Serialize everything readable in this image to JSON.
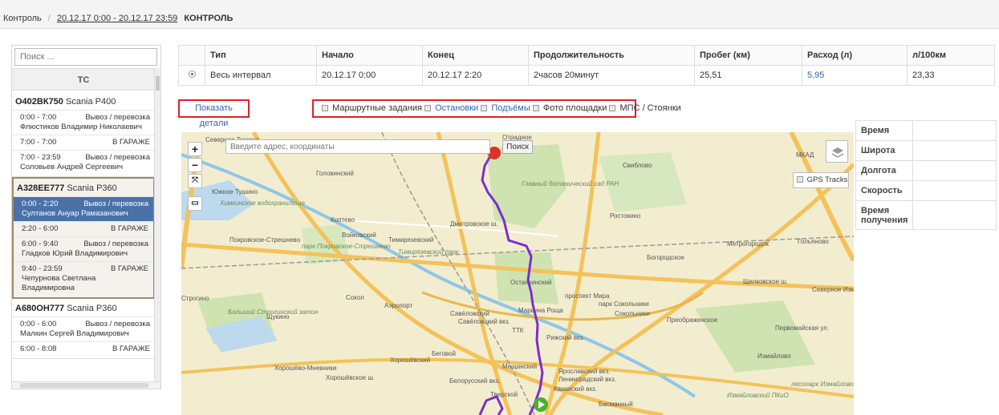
{
  "breadcrumb": {
    "root": "Контроль",
    "range": "20.12.17 0:00 - 20.12.17 23:59",
    "current": "КОНТРОЛЬ"
  },
  "sidebar": {
    "search_placeholder": "Поиск ...",
    "header": "ТС",
    "vehicles": [
      {
        "plate": "О402ВК750",
        "model": "Scania P400",
        "trips": [
          {
            "time": "0:00 - 7:00",
            "status": "Вывоз / перевозка",
            "driver": "Флюстиков Владимир Николаевич"
          },
          {
            "time": "7:00 - 7:00",
            "status": "В ГАРАЖЕ",
            "driver": ""
          },
          {
            "time": "7:00 - 23:59",
            "status": "Вывоз / перевозка",
            "driver": "Соловьев Андрей Сергеевич"
          }
        ]
      },
      {
        "plate": "А328ЕЕ777",
        "model": "Scania P360",
        "trips": [
          {
            "time": "0:00 - 2:20",
            "status": "Вывоз / перевозка",
            "driver": "Султанов Ануар Рамазанович"
          },
          {
            "time": "2:20 - 6:00",
            "status": "В ГАРАЖЕ",
            "driver": ""
          },
          {
            "time": "6:00 - 9:40",
            "status": "Вывоз / перевозка",
            "driver": "Гладков Юрий Владимирович"
          },
          {
            "time": "9:40 - 23:59",
            "status": "В ГАРАЖЕ",
            "driver": "Чепурнова Светлана Владимировна"
          }
        ]
      },
      {
        "plate": "А680ОН777",
        "model": "Scania P360",
        "trips": [
          {
            "time": "0:00 - 6:00",
            "status": "Вывоз / перевозка",
            "driver": "Малкин Сергей Владимирович"
          },
          {
            "time": "6:00 - 8:08",
            "status": "В ГАРАЖЕ",
            "driver": ""
          }
        ]
      }
    ]
  },
  "table": {
    "headers": [
      "",
      "Тип",
      "Начало",
      "Конец",
      "Продолжительность",
      "Пробег (км)",
      "Расход (л)",
      "л/100км"
    ],
    "row": {
      "type": "Весь интервал",
      "start": "20.12.17 0:00",
      "end": "20.12.17 2:20",
      "duration": "2часов 20минут",
      "mileage": "25,51",
      "consumption": "5,95",
      "per100": "23,33"
    }
  },
  "details_button": "Показать детали",
  "filters": [
    "Маршрутные задания",
    "Остановки",
    "Подъёмы",
    "Фото площадки",
    "МПС / Стоянки"
  ],
  "map": {
    "address_placeholder": "Введите адрес, координаты",
    "search_label": "Поиск",
    "gps_label": "GPS Tracks",
    "labels": [
      "Северное Тушино",
      "Головинский",
      "Южное Тушино",
      "Химкинское водохранилище",
      "Коптево",
      "Войковский",
      "Покровское-Стрешнево",
      "парк Покровское-Стрешнево",
      "Тимирязевский",
      "Тимирязевский парк",
      "Дмитровское ш.",
      "Отрадное",
      "Свиблово",
      "Главный ботанический сад РАН",
      "Ростокино",
      "Богородское",
      "Метрогородок",
      "Гольяново",
      "Останкинский",
      "Сокол",
      "Аэропорт",
      "Щукино",
      "Строгино",
      "Большой Строгинский затон",
      "Савёловский",
      "Савёловский вкз.",
      "Марьина Роща",
      "Рижский вкз.",
      "ТТК",
      "проспект Мира",
      "парк Сокольники",
      "Сокольники",
      "Преображенское",
      "Щелковское ш.",
      "Северное Измайлово",
      "Первомайская ул.",
      "Хорошёвский",
      "Беговой",
      "Мещанский",
      "Хорошёво-Мневники",
      "Хорошёвское ш.",
      "Белорусский вкз.",
      "Тверской",
      "Ярославский вкз.",
      "Ленинградский вкз.",
      "Казанский вкз.",
      "Басманный",
      "Измайлово",
      "лесопарк Измайлово",
      "Измайловский ПКиО",
      "МКАД"
    ]
  },
  "info": {
    "time": "Время",
    "lat": "Широта",
    "lon": "Долгота",
    "speed": "Скорость",
    "received": "Время получения"
  },
  "colors": {
    "route": "#7a2fd0",
    "selected_trip": "#4a72a8",
    "highlight_border": "#e0202a",
    "link": "#3366aa"
  }
}
